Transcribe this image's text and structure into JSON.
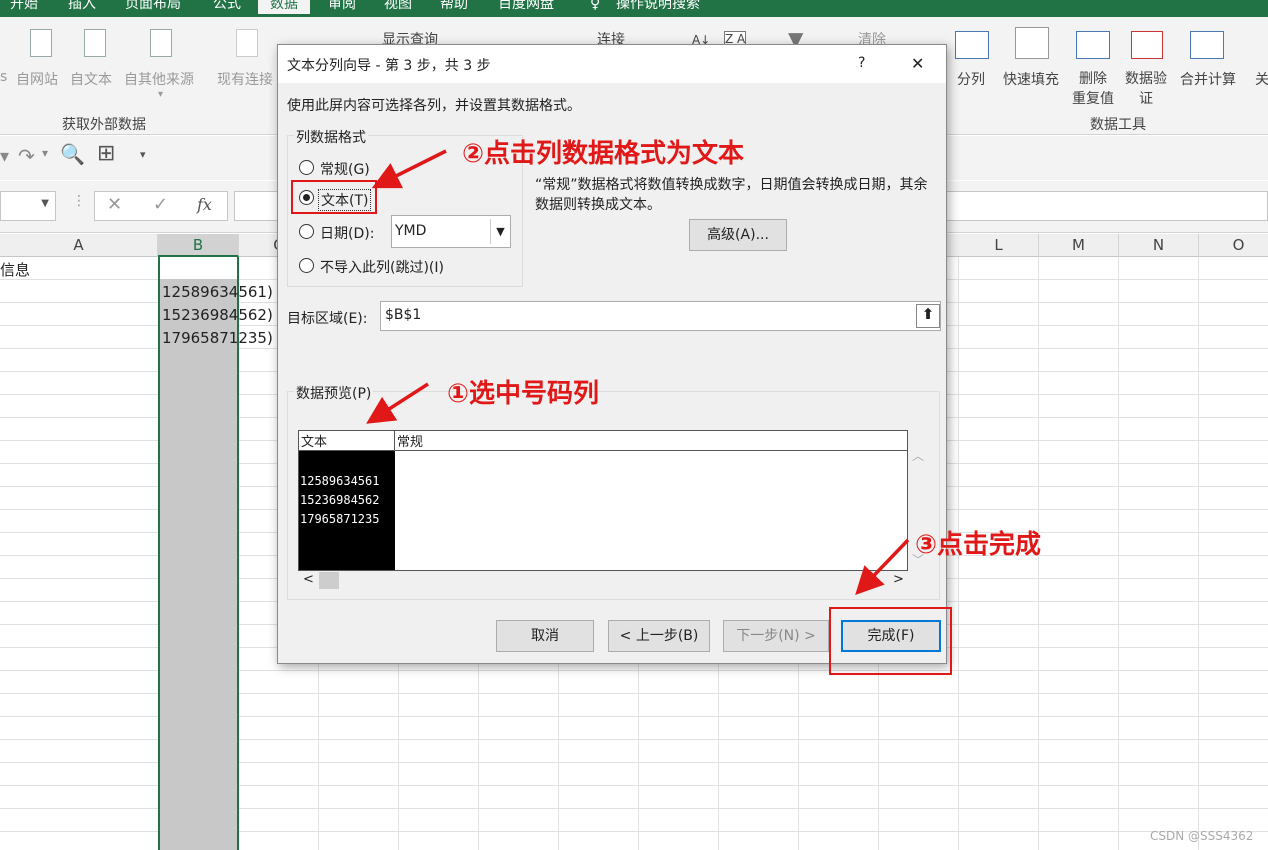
{
  "ribbon_tabs": [
    "开始",
    "插入",
    "页面布局",
    "公式",
    "数据",
    "审阅",
    "视图",
    "帮助",
    "百度网盘",
    "操作说明搜索"
  ],
  "ribbon": {
    "get_external": [
      "s",
      "自网站",
      "自文本",
      "自其他来源",
      "现有连接"
    ],
    "get_external_label": "获取外部数据",
    "query_items": [
      "显示查询",
      "连接"
    ],
    "clear": "清除",
    "sort_letters": [
      "A↓",
      "Z A"
    ],
    "tools": [
      "分列",
      "快速填充",
      "删除\n重复值",
      "数据验\n证",
      "合并计算",
      "关"
    ],
    "tools_label": "数据工具"
  },
  "formula_bar": {
    "fx": "fx",
    "cancel": "✕",
    "confirm": "✓"
  },
  "columns": [
    "A",
    "B",
    "C",
    "L",
    "M",
    "N",
    "O"
  ],
  "cells": {
    "a1": "信息",
    "b2": "1258963456​1)",
    "b3": "1523698456​2)",
    "b4": "1796587123​5)"
  },
  "cells_display": [
    "12589634561)",
    "15236984562)",
    "17965871235)"
  ],
  "dialog": {
    "title": "文本分列向导 - 第 3 步，共 3 步",
    "help": "?",
    "close": "✕",
    "instruction": "使用此屏内容可选择各列，并设置其数据格式。",
    "group_label": "列数据格式",
    "options": [
      "常规(G)",
      "文本(T)",
      "日期(D):",
      "不导入此列(跳过)(I)"
    ],
    "date_format": "YMD",
    "description": "“常规”数据格式将数值转换成数字，日期值会转换成日期，其余数据则转换成文本。",
    "advanced": "高级(A)...",
    "target_label": "目标区域(E):",
    "target_value": "$B$1",
    "preview_label": "数据预览(P)",
    "preview_headers": [
      "文本",
      "常规"
    ],
    "preview_rows": [
      "12589634561",
      "15236984562",
      "17965871235"
    ],
    "buttons": {
      "cancel": "取消",
      "back": "< 上一步(B)",
      "next": "下一步(N) >",
      "finish": "完成(F)"
    }
  },
  "annotations": {
    "step1": "①选中号码列",
    "step2": "②点击列数据格式为文本",
    "step3": "③点击完成"
  },
  "watermark": "CSDN @SSS4362",
  "colors": {
    "excel_green": "#217346",
    "annotation_red": "#e01818"
  }
}
